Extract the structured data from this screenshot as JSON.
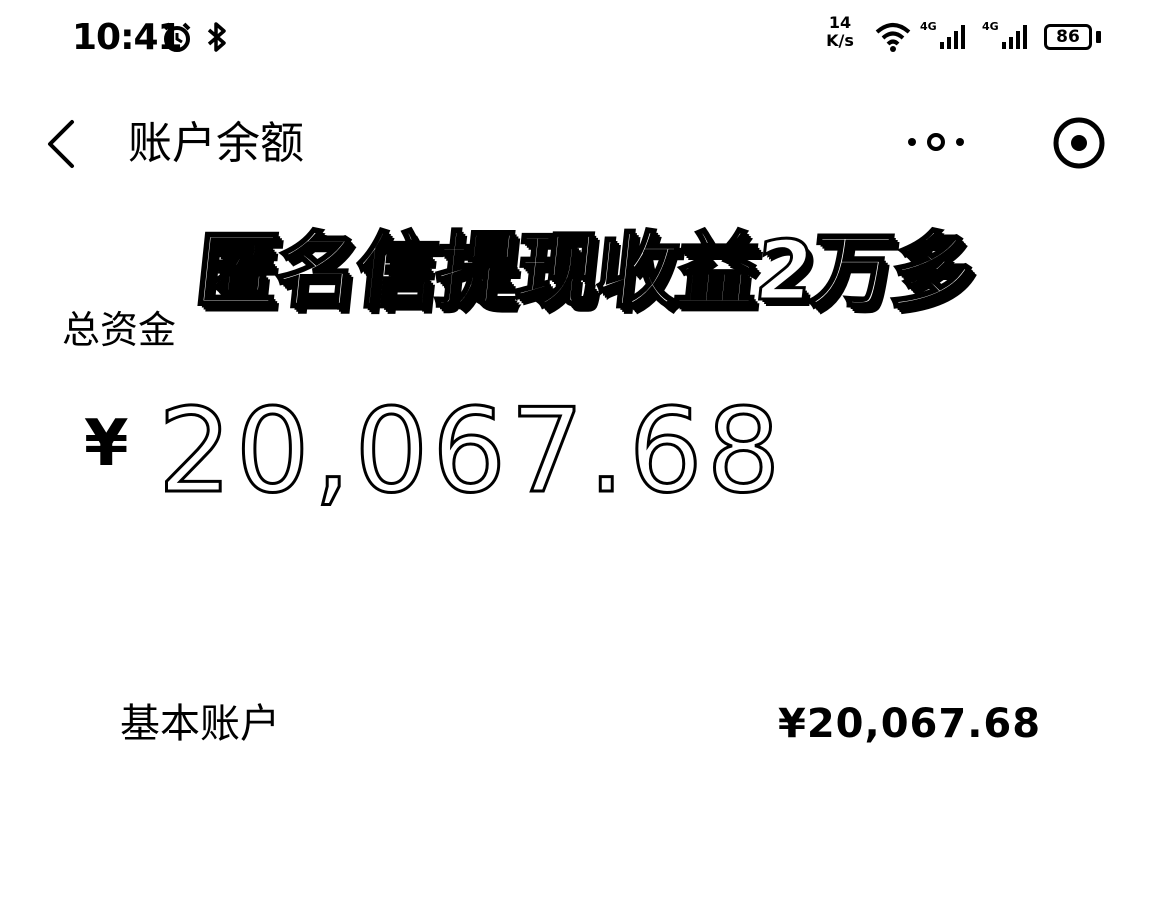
{
  "status_bar": {
    "time": "10:41",
    "net_speed_value": "14",
    "net_speed_unit": "K/s",
    "sim1_label": "4G",
    "sim2_label": "4G",
    "battery_level": "86",
    "icons": [
      "alarm-icon",
      "bluetooth-icon",
      "wifi-icon",
      "signal-icon",
      "signal-icon",
      "battery-icon"
    ]
  },
  "nav": {
    "title": "账户余额",
    "back_icon": "back-icon",
    "more_icon": "more-icon",
    "target_icon": "target-icon"
  },
  "overlay": {
    "caption": "匿名信提现收益2万多"
  },
  "balance": {
    "total_label": "总资金",
    "currency_symbol": "¥",
    "total_amount": "20,067.68"
  },
  "accounts": [
    {
      "label": "基本账户",
      "amount": "¥20,067.68"
    }
  ]
}
